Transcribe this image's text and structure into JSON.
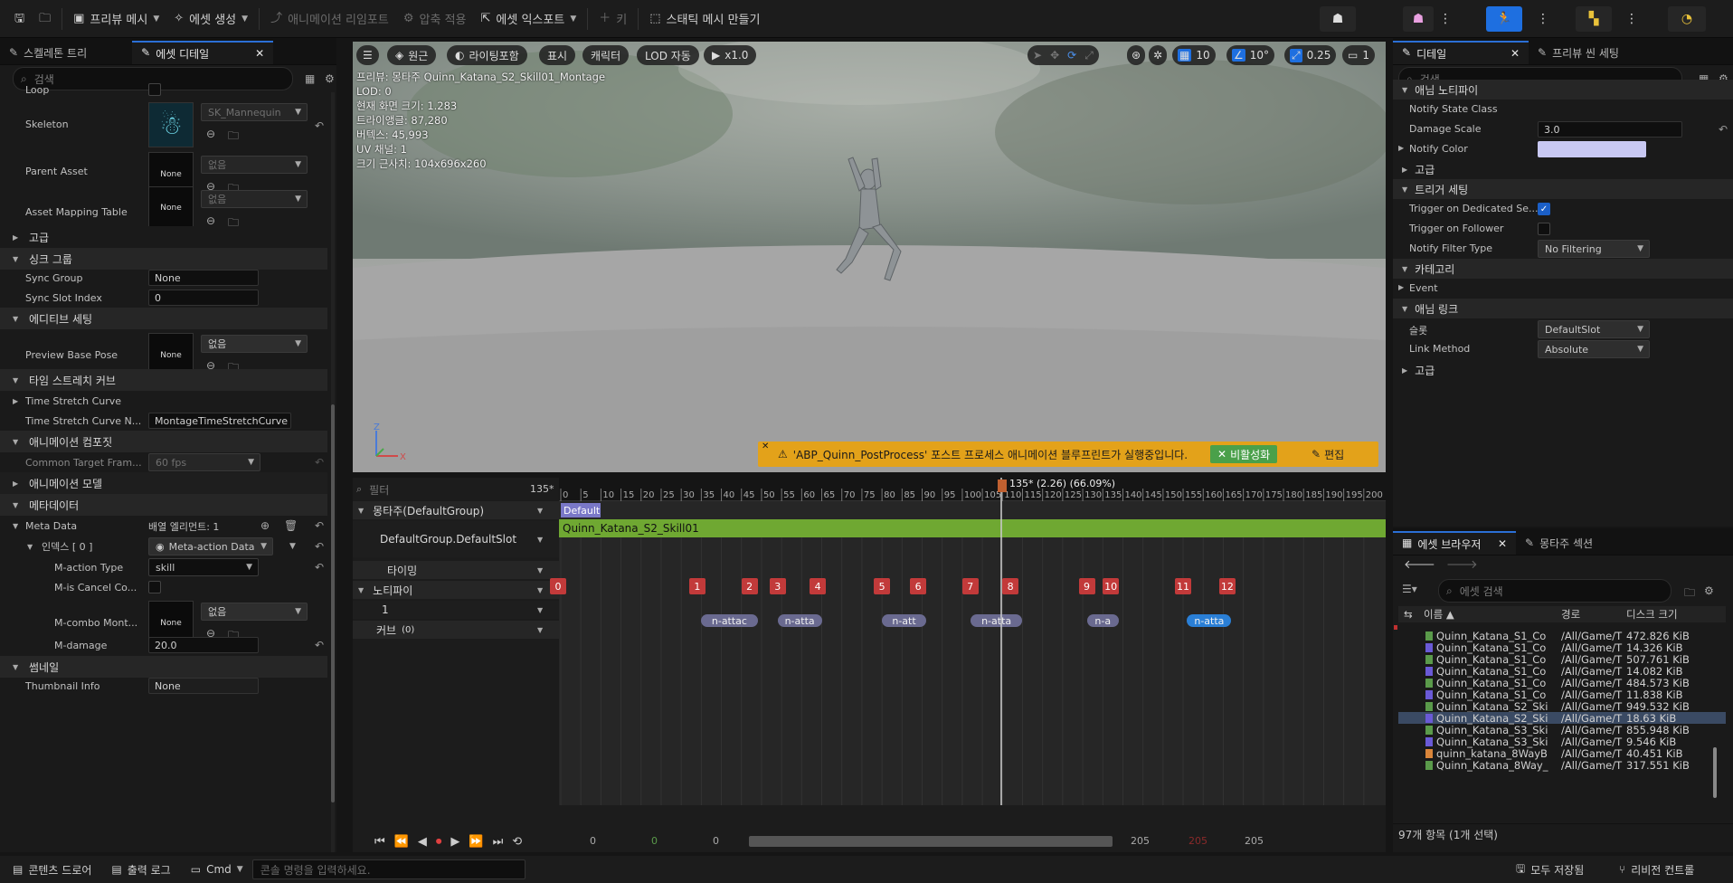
{
  "toolbar": {
    "preview_mesh": "프리뷰 메시",
    "create_asset": "에셋 생성",
    "import_anim": "애니메이션 리임포트",
    "apply_compress": "압축 적용",
    "export_asset": "에셋 익스포트",
    "key": "키",
    "make_static_mesh": "스태틱 메시 만들기"
  },
  "left": {
    "tab_skeleton_tree": "스켈레톤 트리",
    "tab_asset_details": "에셋 디테일",
    "search_placeholder": "검색",
    "loop_label": "Loop",
    "skeleton_label": "Skeleton",
    "skeleton_value": "SK_Mannequin",
    "parent_asset_label": "Parent Asset",
    "none_thumb": "None",
    "none_ko": "없음",
    "asset_mapping_label": "Asset Mapping Table",
    "advanced": "고급",
    "sync_group_section": "싱크 그룹",
    "sync_group_label": "Sync Group",
    "sync_group_value": "None",
    "sync_slot_label": "Sync Slot Index",
    "sync_slot_value": "0",
    "additive_section": "에디티브 세팅",
    "preview_base_pose_label": "Preview Base Pose",
    "time_stretch_section": "타임 스트레치 커브",
    "time_stretch_curve_label": "Time Stretch Curve",
    "time_stretch_curve_name_label": "Time Stretch Curve N...",
    "time_stretch_curve_name_value": "MontageTimeStretchCurve",
    "anim_compression_section": "애니메이션 컴포짓",
    "common_target_label": "Common Target Fram...",
    "common_target_value": "60 fps",
    "anim_model_section": "애니메이션 모델",
    "metadata_section": "메타데이터",
    "meta_data_label": "Meta Data",
    "array_elements": "배열 엘리먼트: 1",
    "index_label": "인덱스 [ 0 ]",
    "meta_action_value": "Meta-action Data",
    "m_action_type_label": "M-action Type",
    "m_action_type_value": "skill",
    "m_is_cancel_label": "M-is Cancel Co...",
    "m_combo_label": "M-combo Mont...",
    "m_damage_label": "M-damage",
    "m_damage_value": "20.0",
    "thumbnail_section": "썸네일",
    "thumbnail_info_label": "Thumbnail Info",
    "thumbnail_info_value": "None"
  },
  "viewport": {
    "btn_origin": "원근",
    "btn_lighting": "라이팅포함",
    "btn_show": "표시",
    "btn_character": "캐릭터",
    "btn_lod": "LOD 자동",
    "btn_speed": "x1.0",
    "grid_value": "10",
    "angle_value": "10°",
    "scale_value": "0.25",
    "cam_value": "1",
    "info": [
      "프리뷰: 몽타주 Quinn_Katana_S2_Skill01_Montage",
      "LOD: 0",
      "현재 화면 크기: 1.283",
      "트라이앵글: 87,280",
      "버텍스: 45,993",
      "UV 채널: 1",
      "크기 근사치: 104x696x260"
    ],
    "warning": "'ABP_Quinn_PostProcess' 포스트 프로세스 애니메이션 블루프린트가 실행중입니다.",
    "disable_btn": "비활성화",
    "edit_btn": "편집"
  },
  "timeline": {
    "filter_placeholder": "필터",
    "frame_count": "135*",
    "playhead_label": "135* (2.26) (66.09%)",
    "montage_track": "몽타주(DefaultGroup)",
    "slot_track": "DefaultGroup.DefaultSlot",
    "timing_track": "타이밍",
    "notify_track": "노티파이",
    "notify_sub": "1",
    "curves_track": "커브",
    "curves_count": "(0)",
    "default_section": "Default",
    "anim_segment": "Quinn_Katana_S2_Skill01",
    "ruler": [
      "0",
      "5",
      "10",
      "15",
      "20",
      "25",
      "30",
      "35",
      "40",
      "45",
      "50",
      "55",
      "60",
      "65",
      "70",
      "75",
      "80",
      "85",
      "90",
      "95",
      "100",
      "105",
      "110",
      "115",
      "120",
      "125",
      "130",
      "135",
      "140",
      "145",
      "150",
      "155",
      "160",
      "165",
      "170",
      "175",
      "180",
      "185",
      "190",
      "195",
      "200"
    ],
    "timing_markers": [
      "0",
      "1",
      "2",
      "3",
      "4",
      "5",
      "6",
      "7",
      "8",
      "9",
      "10",
      "11",
      "12"
    ],
    "notify_states": [
      "n-attac",
      "n-atta",
      "n-att",
      "n-atta",
      "n-a",
      "n-atta"
    ],
    "bottom_values": [
      "0",
      "0",
      "0",
      "205",
      "205",
      "205"
    ]
  },
  "right": {
    "tab_details": "디테일",
    "tab_preview_scene": "프리뷰 씬 세팅",
    "search_placeholder": "검색",
    "anim_notify_section": "애님 노티파이",
    "notify_state_class_label": "Notify State Class",
    "damage_scale_label": "Damage Scale",
    "damage_scale_value": "3.0",
    "notify_color_label": "Notify Color",
    "advanced": "고급",
    "trigger_section": "트리거 세팅",
    "trigger_dedicated_label": "Trigger on Dedicated Se...",
    "trigger_follower_label": "Trigger on Follower",
    "notify_filter_label": "Notify Filter Type",
    "notify_filter_value": "No Filtering",
    "category_section": "카테고리",
    "event_label": "Event",
    "anim_link_section": "애님 링크",
    "slot_label": "슬롯",
    "slot_value": "DefaultSlot",
    "link_method_label": "Link Method",
    "link_method_value": "Absolute",
    "advanced2": "고급"
  },
  "assets": {
    "tab_asset_browser": "에셋 브라우저",
    "tab_montage_sections": "몽타주 섹션",
    "search_placeholder": "에셋 검색",
    "col_name": "이름",
    "col_path": "경로",
    "col_size": "디스크 크기",
    "rows": [
      {
        "name": "Quinn_Katana_S1_Co",
        "path": "/All/Game/T",
        "size": "472.826 KiB",
        "color": "#5a9a4a"
      },
      {
        "name": "Quinn_Katana_S1_Co",
        "path": "/All/Game/T",
        "size": "14.326 KiB",
        "color": "#6a5ad6"
      },
      {
        "name": "Quinn_Katana_S1_Co",
        "path": "/All/Game/T",
        "size": "507.761 KiB",
        "color": "#5a9a4a"
      },
      {
        "name": "Quinn_Katana_S1_Co",
        "path": "/All/Game/T",
        "size": "14.082 KiB",
        "color": "#6a5ad6"
      },
      {
        "name": "Quinn_Katana_S1_Co",
        "path": "/All/Game/T",
        "size": "484.573 KiB",
        "color": "#5a9a4a"
      },
      {
        "name": "Quinn_Katana_S1_Co",
        "path": "/All/Game/T",
        "size": "11.838 KiB",
        "color": "#6a5ad6"
      },
      {
        "name": "Quinn_Katana_S2_Ski",
        "path": "/All/Game/T",
        "size": "949.532 KiB",
        "color": "#5a9a4a"
      },
      {
        "name": "Quinn_Katana_S2_Ski",
        "path": "/All/Game/T",
        "size": "18.63 KiB",
        "color": "#6a5ad6"
      },
      {
        "name": "Quinn_Katana_S3_Ski",
        "path": "/All/Game/T",
        "size": "855.948 KiB",
        "color": "#5a9a4a"
      },
      {
        "name": "Quinn_Katana_S3_Ski",
        "path": "/All/Game/T",
        "size": "9.546 KiB",
        "color": "#6a5ad6"
      },
      {
        "name": "quinn_katana_8WayB",
        "path": "/All/Game/T",
        "size": "40.451 KiB",
        "color": "#d9853a"
      },
      {
        "name": "Quinn_Katana_8Way_",
        "path": "/All/Game/T",
        "size": "317.551 KiB",
        "color": "#5a9a4a"
      }
    ],
    "selected_index": 7,
    "summary": "97개 항목 (1개 선택)"
  },
  "status": {
    "content_drawer": "콘텐츠 드로어",
    "output_log": "출력 로그",
    "cmd": "Cmd",
    "console_placeholder": "콘솔 명령을 입력하세요.",
    "save_all": "모두 저장됨",
    "revision": "리비전 컨트롤"
  },
  "colors": {
    "accent": "#2b6fd6",
    "notify_red": "#c23a3a",
    "segment_green": "#6fa832",
    "warning": "#e3a21a",
    "notify_color_swatch": "#c8c8f2"
  }
}
